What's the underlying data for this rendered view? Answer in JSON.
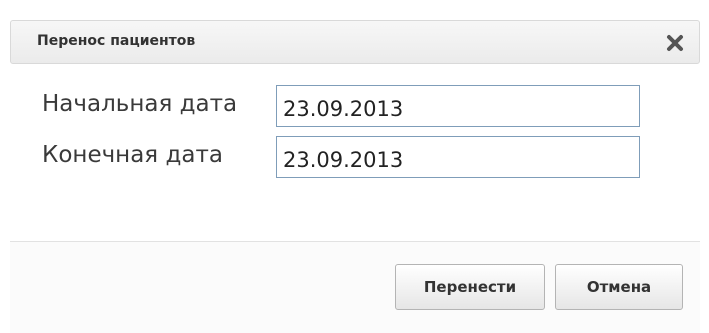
{
  "dialog": {
    "title": "Перенос пациентов",
    "close_icon": "close-icon"
  },
  "form": {
    "start_date_label": "Начальная дата",
    "start_date_value": "23.09.2013",
    "end_date_label": "Конечная дата",
    "end_date_value": "23.09.2013"
  },
  "actions": {
    "transfer_label": "Перенести",
    "cancel_label": "Отмена"
  }
}
